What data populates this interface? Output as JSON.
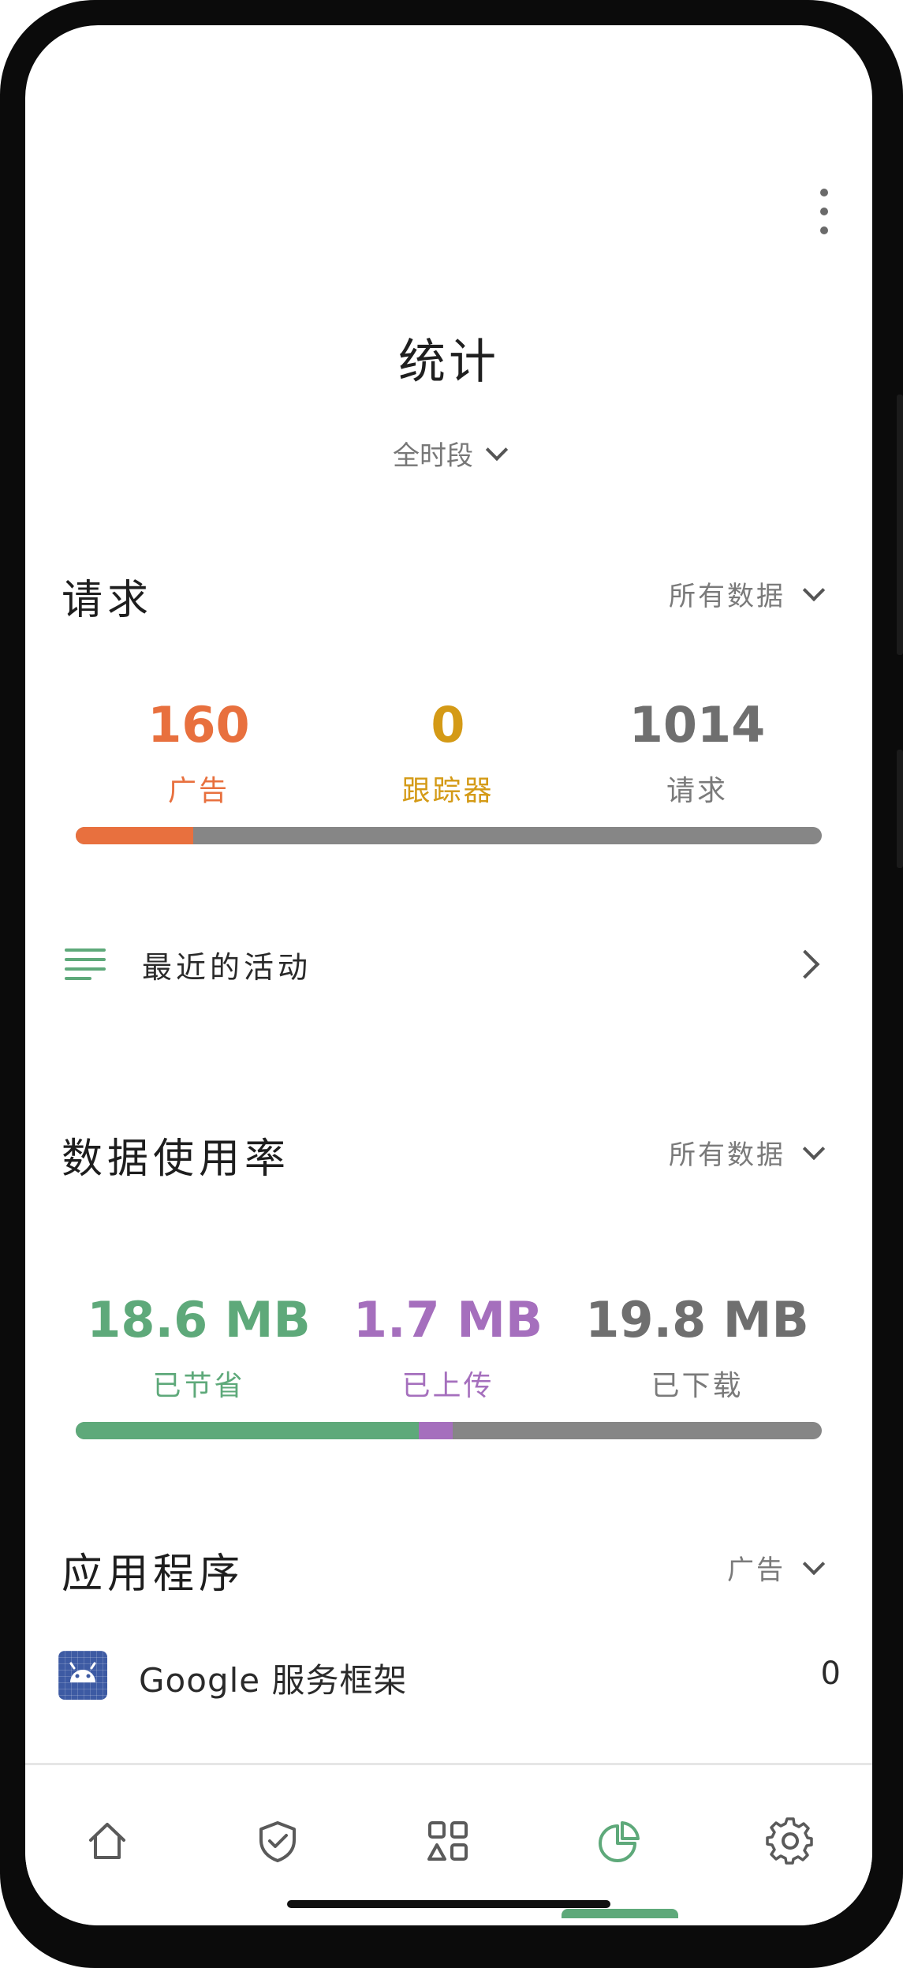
{
  "header": {
    "title": "统计",
    "period": "全时段"
  },
  "requests": {
    "title": "请求",
    "filter": "所有数据",
    "ads": {
      "value": "160",
      "label": "广告",
      "color": "#e8703e"
    },
    "trackers": {
      "value": "0",
      "label": "跟踪器",
      "color": "#d49a16"
    },
    "total": {
      "value": "1014",
      "label": "请求",
      "color": "#6f6f6f"
    },
    "bar": {
      "ads_fraction": 0.158,
      "trackers_fraction": 0.0
    }
  },
  "recent": {
    "label": "最近的活动"
  },
  "data_usage": {
    "title": "数据使用率",
    "filter": "所有数据",
    "saved": {
      "value": "18.6 MB",
      "label": "已节省",
      "color": "#5ea97a"
    },
    "uploaded": {
      "value": "1.7 MB",
      "label": "已上传",
      "color": "#a56fbd"
    },
    "downloaded": {
      "value": "19.8 MB",
      "label": "已下载",
      "color": "#6f6f6f"
    },
    "bar": {
      "saved_fraction": 0.46,
      "uploaded_fraction": 0.045
    }
  },
  "apps": {
    "title": "应用程序",
    "filter": "广告",
    "items": [
      {
        "name": "Google 服务框架",
        "count": "0",
        "icon": "android-icon"
      }
    ]
  },
  "nav": {
    "items": [
      {
        "name": "home-icon",
        "active": false
      },
      {
        "name": "shield-check-icon",
        "active": false
      },
      {
        "name": "apps-grid-icon",
        "active": false
      },
      {
        "name": "pie-chart-icon",
        "active": true
      },
      {
        "name": "gear-icon",
        "active": false
      }
    ],
    "accent": "#5ea97a"
  }
}
